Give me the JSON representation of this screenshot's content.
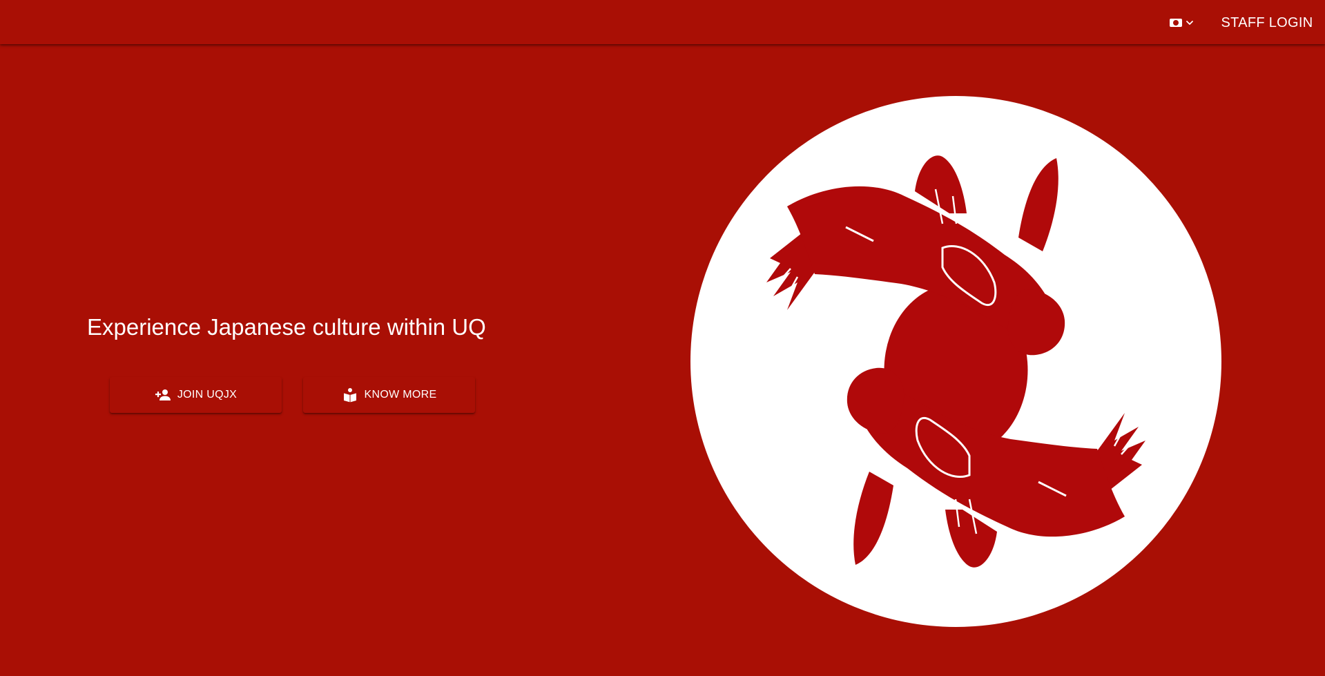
{
  "header": {
    "language_icon": "japan-flag-icon",
    "language_chevron_icon": "chevron-down-icon",
    "staff_login_label": "STAFF LOGIN"
  },
  "hero": {
    "title": "Experience Japanese culture within UQ",
    "buttons": [
      {
        "label": "JOIN UQJX",
        "icon": "person-add-icon"
      },
      {
        "label": "KNOW MORE",
        "icon": "reading-person-icon"
      }
    ]
  },
  "logo": {
    "icon": "koi-fish-logo"
  },
  "colors": {
    "brand_red": "#a90f05",
    "logo_red": "#b0090a",
    "white": "#ffffff"
  }
}
